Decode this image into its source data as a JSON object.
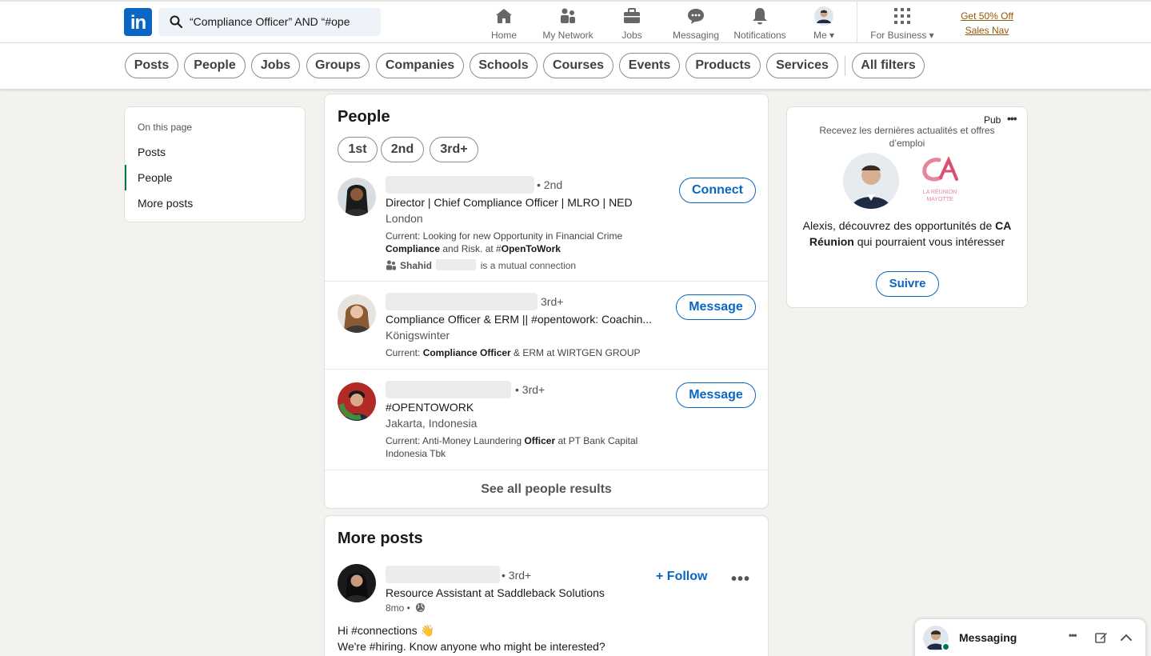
{
  "nav": {
    "search_value": "“Compliance Officer” AND “#opentowork”",
    "items": [
      {
        "label": "Home"
      },
      {
        "label": "My Network"
      },
      {
        "label": "Jobs"
      },
      {
        "label": "Messaging"
      },
      {
        "label": "Notifications"
      },
      {
        "label": "Me"
      }
    ],
    "for_business": "For Business",
    "promo_line1": "Get 50% Off",
    "promo_line2": "Sales Nav"
  },
  "filters": [
    "Posts",
    "People",
    "Jobs",
    "Groups",
    "Companies",
    "Schools",
    "Courses",
    "Events",
    "Products",
    "Services",
    "All filters"
  ],
  "on_this_page": {
    "title": "On this page",
    "items": [
      "Posts",
      "People",
      "More posts"
    ],
    "active": "People"
  },
  "people": {
    "title": "People",
    "connection_filters": [
      "1st",
      "2nd",
      "3rd+"
    ],
    "results": [
      {
        "degree": "• 2nd",
        "headline": "Director | Chief Compliance Officer | MLRO | NED",
        "location": "London",
        "current_prefix": "Current: Looking for new Opportunity in Financial Crime ",
        "current_bold": "Compliance",
        "current_mid": " and Risk. at #",
        "current_bold2": "OpenToWork",
        "mutual_name": "Shahid",
        "mutual_suffix": "is a mutual connection",
        "action": "Connect"
      },
      {
        "degree": "3rd+",
        "headline": "Compliance Officer & ERM || #opentowork: Coachin...",
        "location": "Königswinter",
        "current_prefix": "Current: ",
        "current_bold": "Compliance Officer",
        "current_suffix": " & ERM at WIRTGEN GROUP",
        "action": "Message"
      },
      {
        "degree": "• 3rd+",
        "headline": "#OPENTOWORK",
        "location": "Jakarta, Indonesia",
        "current_prefix": "Current: Anti-Money Laundering ",
        "current_bold": "Officer",
        "current_suffix": " at PT Bank Capital Indonesia Tbk",
        "action": "Message"
      }
    ],
    "see_all": "See all people results"
  },
  "more_posts": {
    "title": "More posts",
    "post": {
      "degree": "• 3rd+",
      "headline": "Resource Assistant at Saddleback Solutions",
      "time": "8mo •",
      "follow_label": "+ Follow",
      "line1": "Hi #connections 👋",
      "line2": "We're #hiring. Know anyone who might be interested?"
    }
  },
  "ad": {
    "badge": "Pub",
    "tagline": "Recevez les dernières actualités et offres d’emploi",
    "brand_text": "LA RÉUNION MAYOTTE",
    "body_prefix": "Alexis, découvrez des opportunités de ",
    "body_bold": "CA Réunion",
    "body_suffix": " qui pourraient vous intéresser",
    "cta": "Suivre"
  },
  "messaging": {
    "label": "Messaging"
  },
  "colors": {
    "brand": "#0a66c2",
    "active_indicator": "#01754f",
    "promo": "#915907"
  }
}
